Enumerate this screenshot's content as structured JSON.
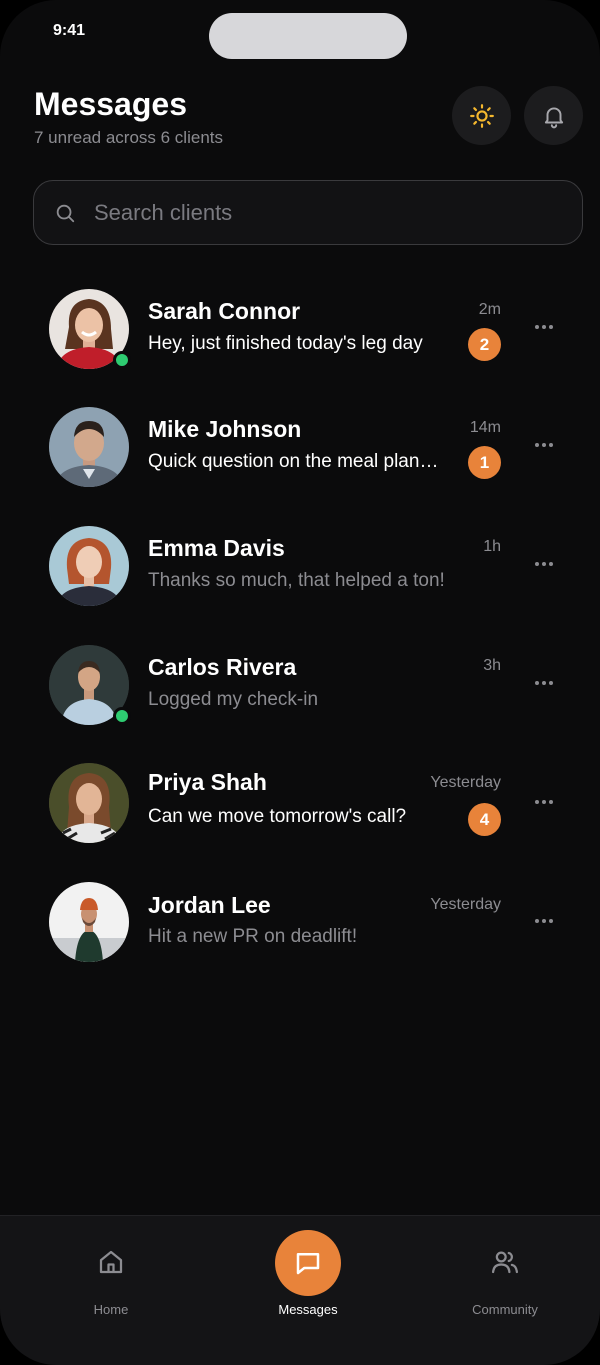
{
  "status_bar": {
    "time": "9:41"
  },
  "header": {
    "title": "Messages",
    "subtitle": "7 unread across 6 clients",
    "theme_icon": "sun-icon",
    "notifications_icon": "bell-icon"
  },
  "search": {
    "placeholder": "Search clients",
    "value": ""
  },
  "colors": {
    "accent": "#e8833a",
    "online": "#2ecc71",
    "background": "#0b0b0c"
  },
  "conversations": [
    {
      "name": "Sarah Connor",
      "preview": "Hey, just finished today's leg day",
      "time": "2m",
      "unread": "2",
      "online": true
    },
    {
      "name": "Mike Johnson",
      "preview": "Quick question on the meal plan…",
      "time": "14m",
      "unread": "1",
      "online": false
    },
    {
      "name": "Emma Davis",
      "preview": "Thanks so much, that helped a ton!",
      "time": "1h",
      "unread": "",
      "online": false
    },
    {
      "name": "Carlos Rivera",
      "preview": "Logged my check-in",
      "time": "3h",
      "unread": "",
      "online": true
    },
    {
      "name": "Priya Shah",
      "preview": "Can we move tomorrow's call?",
      "time": "Yesterday",
      "unread": "4",
      "online": false
    },
    {
      "name": "Jordan Lee",
      "preview": "Hit a new PR on deadlift!",
      "time": "Yesterday",
      "unread": "",
      "online": false
    }
  ],
  "tabbar": {
    "home": {
      "label": "Home",
      "icon": "home-icon"
    },
    "messages": {
      "label": "Messages",
      "icon": "chat-icon"
    },
    "community": {
      "label": "Community",
      "icon": "users-icon"
    }
  }
}
